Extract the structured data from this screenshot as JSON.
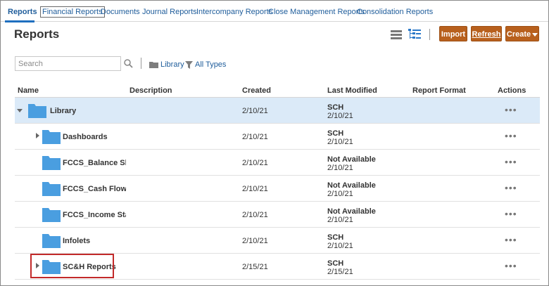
{
  "tabs": [
    {
      "label": "Reports"
    },
    {
      "label": "Financial Reports"
    },
    {
      "label": "Documents"
    },
    {
      "label": "Journal Reports"
    },
    {
      "label": "Intercompany Reports"
    },
    {
      "label": "Close Management Reports"
    },
    {
      "label": "Consolidation Reports"
    }
  ],
  "page": {
    "title": "Reports"
  },
  "toolbar": {
    "import_label": "Import",
    "refresh_label": "Refresh",
    "create_label": "Create"
  },
  "search": {
    "placeholder": "Search",
    "value": ""
  },
  "filters": {
    "folder_label": "Library",
    "type_label": "All Types"
  },
  "columns": {
    "name": "Name",
    "description": "Description",
    "created": "Created",
    "last_modified": "Last Modified",
    "report_format": "Report Format",
    "actions": "Actions"
  },
  "rows": [
    {
      "name": "Library",
      "created": "2/10/21",
      "modified_by": "SCH",
      "modified_date": "2/10/21",
      "actions": "•••"
    },
    {
      "name": "Dashboards",
      "created": "2/10/21",
      "modified_by": "SCH",
      "modified_date": "2/10/21",
      "actions": "•••"
    },
    {
      "name": "FCCS_Balance Shee",
      "created": "2/10/21",
      "modified_by": "Not Available",
      "modified_date": "2/10/21",
      "actions": "•••"
    },
    {
      "name": "FCCS_Cash Flow",
      "created": "2/10/21",
      "modified_by": "Not Available",
      "modified_date": "2/10/21",
      "actions": "•••"
    },
    {
      "name": "FCCS_Income Stater",
      "created": "2/10/21",
      "modified_by": "Not Available",
      "modified_date": "2/10/21",
      "actions": "•••"
    },
    {
      "name": "Infolets",
      "created": "2/10/21",
      "modified_by": "SCH",
      "modified_date": "2/10/21",
      "actions": "•••"
    },
    {
      "name": "SC&H Reports",
      "created": "2/15/21",
      "modified_by": "SCH",
      "modified_date": "2/15/21",
      "actions": "•••"
    }
  ],
  "colors": {
    "accent": "#b8601d",
    "link": "#1f5d9b",
    "folder": "#4a9ee0",
    "selected_row": "#dbeaf8",
    "highlight": "#c22a2a"
  }
}
